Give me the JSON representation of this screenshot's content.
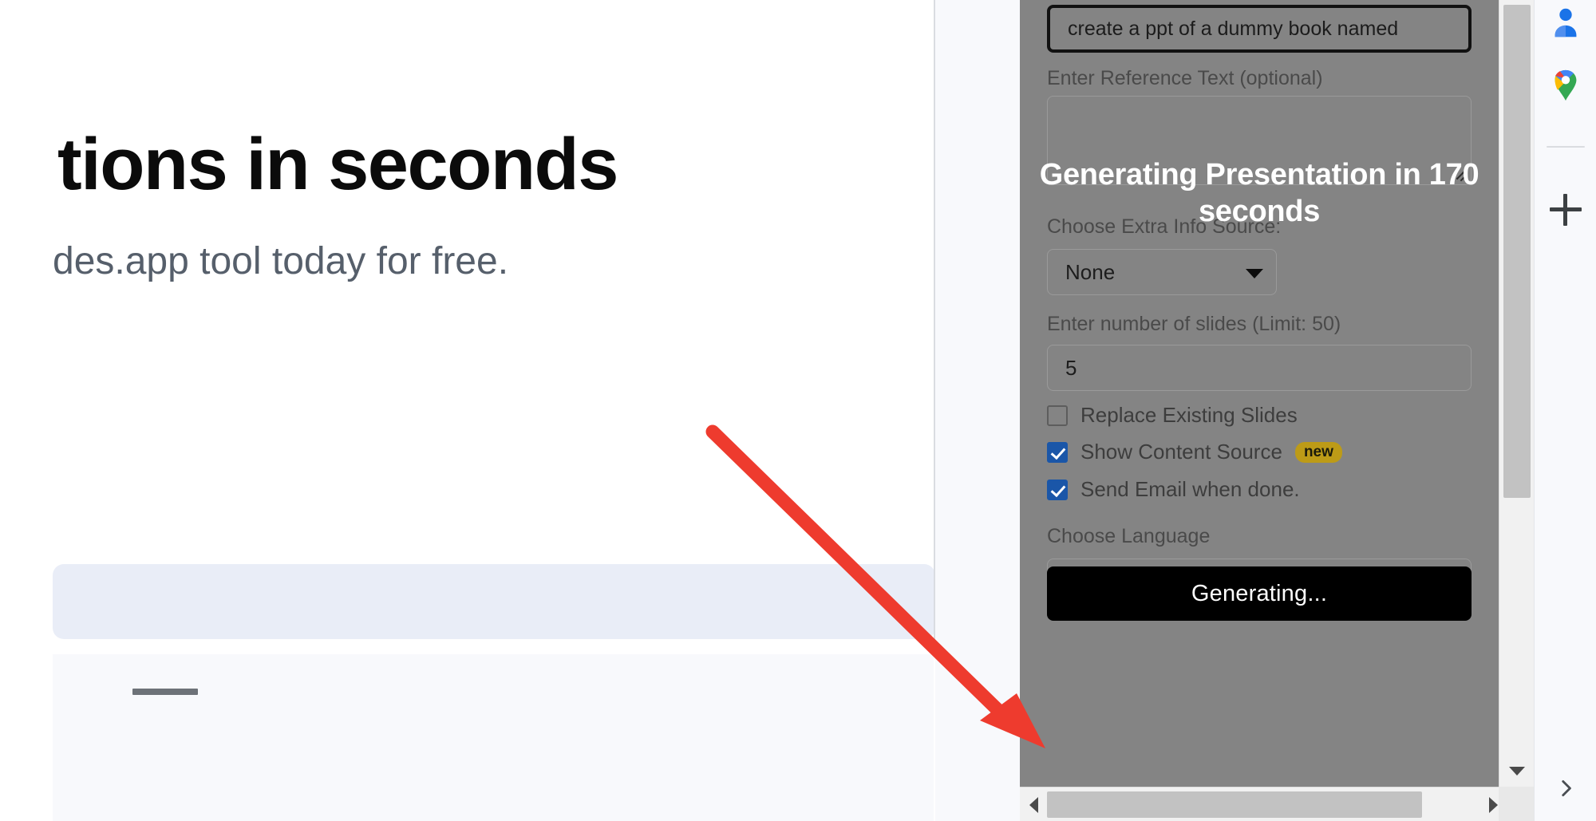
{
  "page": {
    "hero_title": "tions in seconds",
    "hero_subtitle": "des.app tool today for free."
  },
  "dialog": {
    "prompt_value": "create a ppt of a dummy book named",
    "reference_label": "Enter Reference Text (optional)",
    "reference_value": "",
    "extra_info_label": "Choose Extra Info Source:",
    "extra_info_value": "None",
    "slides_label": "Enter number of slides (Limit: 50)",
    "slides_value": "5",
    "checkboxes": [
      {
        "label": "Replace Existing Slides",
        "checked": false,
        "badge": ""
      },
      {
        "label": "Show Content Source",
        "checked": true,
        "badge": "new"
      },
      {
        "label": "Send Email when done.",
        "checked": true,
        "badge": ""
      }
    ],
    "language_label": "Choose Language",
    "submit_label": "Generating...",
    "overlay_text": "Generating Presentation in 170 seconds",
    "overlay_color": "#ffffff",
    "submit_bg": "#000000",
    "checkbox_accent": "#1a56a8",
    "badge_color": "#bd9b17"
  },
  "annotation": {
    "arrow_color": "#ee3b2e"
  },
  "google_sidebar": {
    "icons": [
      "contacts-icon",
      "maps-icon",
      "add-icon",
      "chevron-right-icon"
    ]
  }
}
